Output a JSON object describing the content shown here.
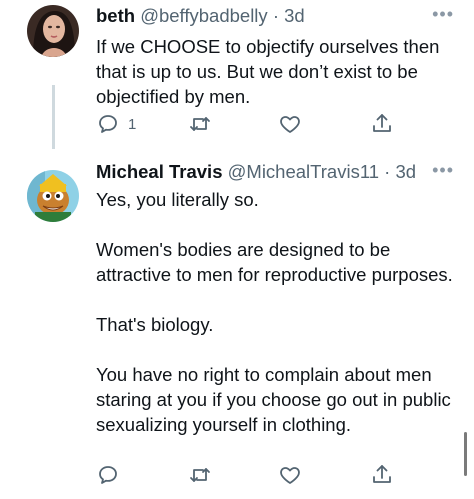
{
  "tweets": [
    {
      "name": "beth",
      "handle": "@beffybadbelly",
      "separator": "·",
      "time": "3d",
      "more_icon": "more-horizontal-icon",
      "text": "If we CHOOSE to objectify ourselves then that is up to us. But we don’t exist to be objectified by men.",
      "reply_count": "1"
    },
    {
      "name": "Micheal Travis",
      "handle": "@MichealTravis11",
      "separator": "·",
      "time": "3d",
      "more_icon": "more-horizontal-icon",
      "text": "Yes, you literally so.\n\nWomen's bodies are designed to be attractive to men for reproductive purposes.\n\nThat's biology.\n\nYou have no right to complain about men staring at you if you choose go out in public sexualizing yourself in clothing."
    }
  ],
  "icons": [
    "reply-icon",
    "retweet-icon",
    "like-icon",
    "share-icon"
  ],
  "colors": {
    "text": "#0f1419",
    "secondary": "#536471",
    "thread_line": "#cfd9de"
  }
}
